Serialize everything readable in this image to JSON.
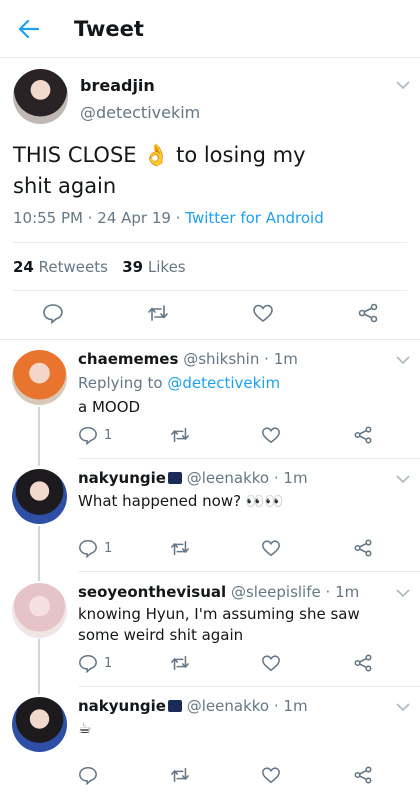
{
  "header": {
    "title": "Tweet"
  },
  "main_tweet": {
    "display_name": "breadjin",
    "handle": "@detectivekim",
    "text_1": "THIS CLOSE",
    "text_2": "to losing my",
    "text_3": "shit again",
    "time": "10:55 PM",
    "date": "24 Apr 19",
    "source": "Twitter for Android",
    "retweets_count": "24",
    "retweets_label": "Retweets",
    "likes_count": "39",
    "likes_label": "Likes"
  },
  "replies": [
    {
      "name": "chaememes",
      "handle": "@shikshin",
      "time": "1m",
      "reply_prefix": "Replying to",
      "reply_to": "@detectivekim",
      "text": "a MOOD",
      "reply_count": "1"
    },
    {
      "name": "nakyungie",
      "handle": "@leenakko",
      "time": "1m",
      "text": "What happened now? 👀👀",
      "reply_count": "1"
    },
    {
      "name": "seoyeonthevisual",
      "handle": "@sleepislife",
      "time": "1m",
      "text": "knowing Hyun, I'm assuming she saw some weird shit again",
      "reply_count": "1"
    },
    {
      "name": "nakyungie",
      "handle": "@leenakko",
      "time": "1m",
      "text": "☕",
      "reply_count": ""
    }
  ],
  "colors": {
    "accent": "#1da1f2",
    "muted": "#657786",
    "text": "#14171a",
    "divider": "#e6ecf0"
  }
}
